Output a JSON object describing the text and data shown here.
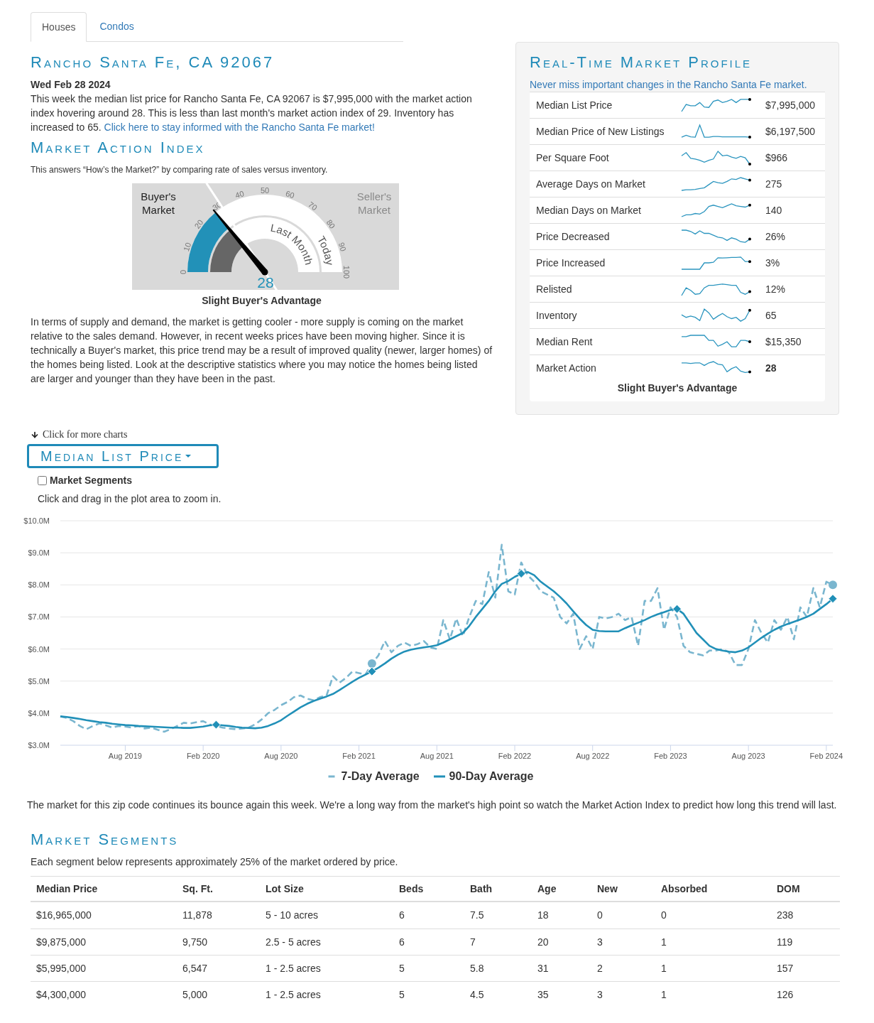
{
  "tabs": [
    {
      "label": "Houses",
      "selected": true
    },
    {
      "label": "Condos",
      "selected": false
    }
  ],
  "location_heading": "Rancho Santa Fe, CA 92067",
  "summary": {
    "date": "Wed Feb 28 2024",
    "text": "This week the median list price for Rancho Santa Fe, CA 92067 is $7,995,000 with the market action index hovering around 28. This is less than last month's market action index of 29. Inventory has increased to 65.",
    "link": "Click here to stay informed with the Rancho Santa Fe market!"
  },
  "market_action_index": {
    "heading": "Market Action Index",
    "subtitle": "This answers “How’s the Market?” by comparing rate of sales versus inventory.",
    "gauge": {
      "sides": [
        {
          "label": "Buyer's Market",
          "active": true
        },
        {
          "label": "Seller's Market",
          "active": false
        }
      ],
      "scale": [
        "0",
        "10",
        "20",
        "30",
        "40",
        "50",
        "60",
        "70",
        "80",
        "90",
        "100"
      ],
      "rings": [
        {
          "label": "Last Month",
          "level": 0.29,
          "color": "#666666"
        },
        {
          "label": "Today",
          "level": 0.28,
          "color": "#2291b8"
        }
      ],
      "reading": "28"
    },
    "verdict": "Slight Buyer's Advantage",
    "analysis": "In terms of supply and demand, the market is getting cooler - more supply is coming on the market relative to the sales demand. However, in recent weeks prices have been moving higher. Since it is technically a Buyer's market, this price trend may be a result of improved quality (newer, larger homes) of the homes being listed. Look at the descriptive statistics where you may notice the homes being listed are larger and younger than they have been in the past."
  },
  "market_profile": {
    "heading": "Real-Time Market Profile",
    "link": "Never miss important changes in the Rancho Santa Fe market.",
    "rows": [
      {
        "label": "Median List Price",
        "value": "$7,995,000",
        "kind": "metric"
      },
      {
        "label": "Median Price of New Listings",
        "value": "$6,197,500",
        "kind": "metric"
      },
      {
        "label": "Per Square Foot",
        "value": "$966",
        "kind": "metric"
      },
      {
        "label": "Average Days on Market",
        "value": "275",
        "kind": "metric"
      },
      {
        "label": "Median Days on Market",
        "value": "140",
        "kind": "metric"
      },
      {
        "label": "Price Decreased",
        "value": "26%",
        "kind": "metric"
      },
      {
        "label": "Price Increased",
        "value": "3%",
        "kind": "metric"
      },
      {
        "label": "Relisted",
        "value": "12%",
        "kind": "metric"
      },
      {
        "label": "Inventory",
        "value": "65",
        "kind": "metric"
      },
      {
        "label": "Median Rent",
        "value": "$15,350",
        "kind": "metric"
      },
      {
        "label": "Market Action",
        "value": "28",
        "kind": "index"
      }
    ],
    "verdict": "Slight Buyer's Advantage"
  },
  "charts": {
    "hint": "Click for more charts",
    "selector": "Median List Price",
    "segments_checkbox": {
      "label": "Market Segments",
      "checked": false
    },
    "zoom_hint": "Click and drag in the plot area to zoom in.",
    "chart_data": {
      "type": "line",
      "grid": true,
      "legend": "bottom",
      "categories": [
        null,
        null,
        null,
        null,
        null,
        null,
        null,
        null,
        null,
        null,
        "Aug 2019",
        null,
        null,
        null,
        null,
        null,
        null,
        null,
        null,
        null,
        null,
        null,
        "Feb 2020",
        null,
        null,
        null,
        null,
        null,
        null,
        null,
        null,
        null,
        null,
        null,
        "Aug 2020",
        null,
        null,
        null,
        null,
        null,
        null,
        null,
        null,
        null,
        null,
        null,
        "Feb 2021",
        null,
        null,
        null,
        null,
        null,
        null,
        null,
        null,
        null,
        null,
        null,
        "Aug 2021",
        null,
        null,
        null,
        null,
        null,
        null,
        null,
        null,
        null,
        null,
        null,
        "Feb 2022",
        null,
        null,
        null,
        null,
        null,
        null,
        null,
        null,
        null,
        null,
        null,
        "Aug 2022",
        null,
        null,
        null,
        null,
        null,
        null,
        null,
        null,
        null,
        null,
        null,
        "Feb 2023",
        null,
        null,
        null,
        null,
        null,
        null,
        null,
        null,
        null,
        null,
        null,
        "Aug 2023",
        null,
        null,
        null,
        null,
        null,
        null,
        null,
        null,
        null,
        null,
        null,
        "Feb 2024",
        null
      ],
      "ylim": [
        3,
        10
      ],
      "yticks": [
        {
          "value": 3,
          "label": "$3.0M"
        },
        {
          "value": 4,
          "label": "$4.0M"
        },
        {
          "value": 5,
          "label": "$5.0M"
        },
        {
          "value": 6,
          "label": "$6.0M"
        },
        {
          "value": 7,
          "label": "$7.0M"
        },
        {
          "value": 8,
          "label": "$8.0M"
        },
        {
          "value": 9,
          "label": "$9.0M"
        },
        {
          "value": 10,
          "label": "$10.0M"
        }
      ],
      "series": [
        {
          "name": "7-Day Average",
          "color": "#7ab6cf",
          "line_style": "dashed",
          "values": [
            3.9,
            3.85,
            3.75,
            3.6,
            3.5,
            3.6,
            3.68,
            3.62,
            3.55,
            3.6,
            3.58,
            3.55,
            3.6,
            3.52,
            3.55,
            3.48,
            3.42,
            3.5,
            3.6,
            3.7,
            3.68,
            3.72,
            3.75,
            3.65,
            3.6,
            3.55,
            3.52,
            3.5,
            3.52,
            3.55,
            3.65,
            3.8,
            4.0,
            4.1,
            4.25,
            4.35,
            4.5,
            4.55,
            4.45,
            4.4,
            4.5,
            4.55,
            5.15,
            4.95,
            5.1,
            5.3,
            5.25,
            5.2,
            5.55,
            5.8,
            6.25,
            5.9,
            6.1,
            6.2,
            6.1,
            6.15,
            6.25,
            6.05,
            6.0,
            6.9,
            6.3,
            6.95,
            6.4,
            7.0,
            7.5,
            7.4,
            8.4,
            7.6,
            9.25,
            7.8,
            7.7,
            8.7,
            8.3,
            8.1,
            7.8,
            7.7,
            7.6,
            7.0,
            6.8,
            7.1,
            6.0,
            6.4,
            6.0,
            7.0,
            6.95,
            7.0,
            7.1,
            6.9,
            7.0,
            6.1,
            7.5,
            7.5,
            7.9,
            6.6,
            7.3,
            7.0,
            6.1,
            5.9,
            5.85,
            5.8,
            5.95,
            5.95,
            6.0,
            5.9,
            5.5,
            5.5,
            6.0,
            6.9,
            6.5,
            6.2,
            6.9,
            6.6,
            7.0,
            6.3,
            7.3,
            7.0,
            7.9,
            7.3,
            8.1,
            8.0
          ]
        },
        {
          "name": "90-Day Average",
          "color": "#2190b8",
          "line_style": "solid",
          "values": [
            3.9,
            3.88,
            3.85,
            3.82,
            3.78,
            3.75,
            3.72,
            3.7,
            3.67,
            3.65,
            3.63,
            3.62,
            3.6,
            3.59,
            3.58,
            3.57,
            3.56,
            3.55,
            3.55,
            3.54,
            3.54,
            3.56,
            3.58,
            3.62,
            3.64,
            3.62,
            3.6,
            3.57,
            3.55,
            3.54,
            3.53,
            3.55,
            3.6,
            3.68,
            3.78,
            3.92,
            4.05,
            4.18,
            4.29,
            4.38,
            4.45,
            4.52,
            4.6,
            4.72,
            4.85,
            4.98,
            5.1,
            5.2,
            5.3,
            5.42,
            5.55,
            5.7,
            5.82,
            5.92,
            5.98,
            6.02,
            6.05,
            6.08,
            6.12,
            6.2,
            6.3,
            6.4,
            6.5,
            6.72,
            7.0,
            7.25,
            7.5,
            7.8,
            8.03,
            8.12,
            8.25,
            8.35,
            8.4,
            8.3,
            8.1,
            7.95,
            7.8,
            7.62,
            7.42,
            7.18,
            6.95,
            6.75,
            6.6,
            6.56,
            6.55,
            6.55,
            6.55,
            6.65,
            6.74,
            6.82,
            6.9,
            7.0,
            7.08,
            7.15,
            7.22,
            7.25,
            7.1,
            6.8,
            6.5,
            6.3,
            6.1,
            6.0,
            5.95,
            5.92,
            5.9,
            5.95,
            6.05,
            6.2,
            6.35,
            6.48,
            6.6,
            6.7,
            6.78,
            6.85,
            6.92,
            7.0,
            7.1,
            7.25,
            7.4,
            7.57
          ]
        }
      ]
    },
    "commentary": "The market for this zip code continues its bounce again this week. We're a long way from the market's high point so watch the Market Action Index to predict how long this trend will last."
  },
  "market_segments": {
    "heading": "Market Segments",
    "note": "Each segment below represents approximately 25% of the market ordered by price.",
    "table": {
      "columns": [
        "Median Price",
        "Sq. Ft.",
        "Lot Size",
        "Beds",
        "Bath",
        "Age",
        "New",
        "Absorbed",
        "DOM"
      ],
      "rows": [
        [
          "$16,965,000",
          "11,878",
          "5 - 10 acres",
          "6",
          "7.5",
          "18",
          "0",
          "0",
          "238"
        ],
        [
          "$9,875,000",
          "9,750",
          "2.5 - 5 acres",
          "6",
          "7",
          "20",
          "3",
          "1",
          "119"
        ],
        [
          "$5,995,000",
          "6,547",
          "1 - 2.5 acres",
          "5",
          "5.8",
          "31",
          "2",
          "1",
          "157"
        ],
        [
          "$4,300,000",
          "5,000",
          "1 - 2.5 acres",
          "5",
          "4.5",
          "35",
          "3",
          "1",
          "126"
        ]
      ]
    }
  }
}
